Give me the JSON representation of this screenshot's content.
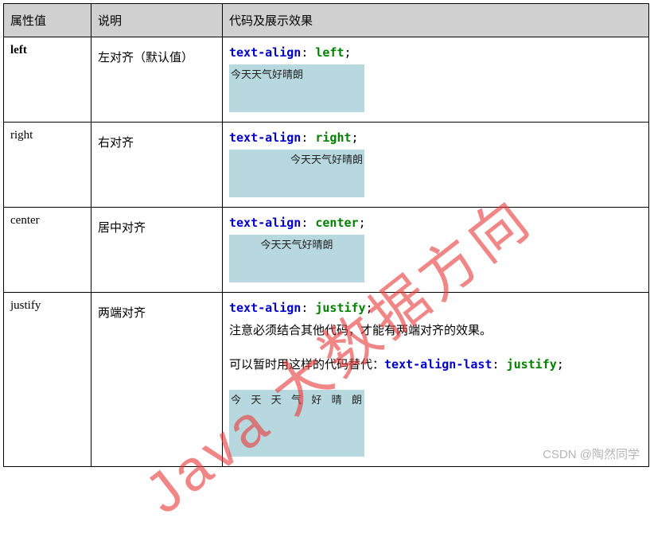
{
  "headers": {
    "col1": "属性值",
    "col2": "说明",
    "col3": "代码及展示效果"
  },
  "rows": [
    {
      "value": "left",
      "value_bold": true,
      "desc": "左对齐（默认值）",
      "code_prop": "text-align",
      "code_val": "left",
      "demo_text": "今天天气好晴朗",
      "demo_align": "left"
    },
    {
      "value": "right",
      "value_bold": false,
      "desc": "右对齐",
      "code_prop": "text-align",
      "code_val": "right",
      "demo_text": "今天天气好晴朗",
      "demo_align": "right"
    },
    {
      "value": "center",
      "value_bold": false,
      "desc": "居中对齐",
      "code_prop": "text-align",
      "code_val": "center",
      "demo_text": "今天天气好晴朗",
      "demo_align": "center"
    },
    {
      "value": "justify",
      "value_bold": false,
      "desc": "两端对齐",
      "code_prop": "text-align",
      "code_val": "justify",
      "note1": "注意必须结合其他代码，才能有两端对齐的效果。",
      "note2_prefix": "可以暂时用这样的代码替代：",
      "note2_prop": "text-align-last",
      "note2_val": "justify",
      "demo_text": "今 天 天 气 好 晴 朗",
      "demo_align": "justify"
    }
  ],
  "watermark_diag": "Java 大数据方向",
  "watermark_csdn": "CSDN @陶然同学"
}
